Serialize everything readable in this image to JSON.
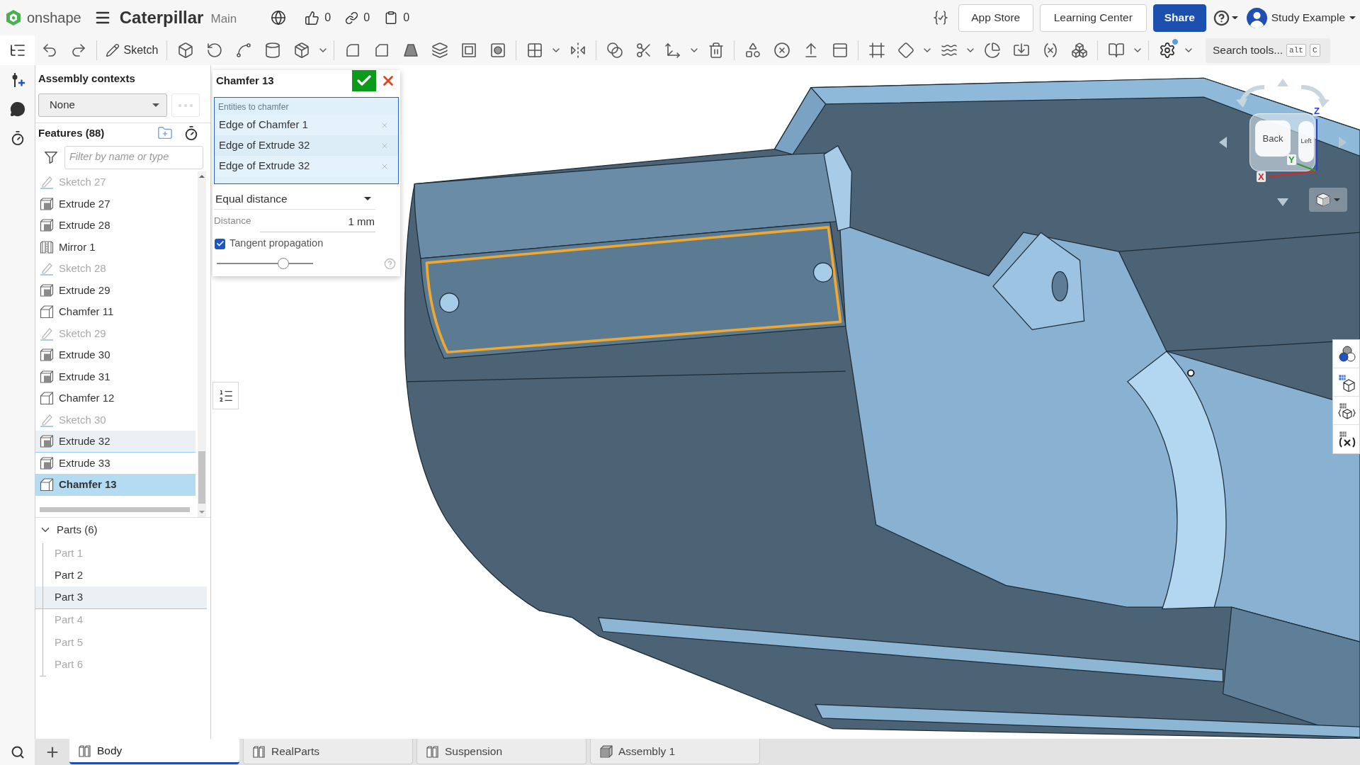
{
  "header": {
    "logo": "onshape",
    "title": "Caterpillar",
    "branch": "Main",
    "counters": [
      {
        "kind": "likes",
        "value": "0"
      },
      {
        "kind": "links",
        "value": "0"
      },
      {
        "kind": "copies",
        "value": "0"
      }
    ],
    "buttons": [
      {
        "label": "App Store",
        "kind": "outline"
      },
      {
        "label": "Learning Center",
        "kind": "outline"
      },
      {
        "label": "Share",
        "kind": "primary"
      }
    ],
    "user": "Study Example"
  },
  "toolbar": {
    "sketch_label": "Sketch",
    "search": {
      "label": "Search tools...",
      "keys": [
        "alt",
        "C"
      ]
    }
  },
  "assembly_contexts": {
    "title": "Assembly contexts",
    "value": "None",
    "more_button": {
      "disabled": true
    }
  },
  "features": {
    "title": "Features (88)",
    "filter_placeholder": "Filter by name or type",
    "items": [
      {
        "label": "Sketch 27",
        "kind": "sketch",
        "hidden": true,
        "highlighted": false,
        "selected": false
      },
      {
        "label": "Extrude 27",
        "kind": "extrude",
        "hidden": false,
        "highlighted": false,
        "selected": false
      },
      {
        "label": "Extrude 28",
        "kind": "extrude",
        "hidden": false,
        "highlighted": false,
        "selected": false
      },
      {
        "label": "Mirror 1",
        "kind": "mirror",
        "hidden": false,
        "highlighted": false,
        "selected": false
      },
      {
        "label": "Sketch 28",
        "kind": "sketch",
        "hidden": true,
        "highlighted": false,
        "selected": false
      },
      {
        "label": "Extrude 29",
        "kind": "extrude",
        "hidden": false,
        "highlighted": false,
        "selected": false
      },
      {
        "label": "Chamfer 11",
        "kind": "chamfer",
        "hidden": false,
        "highlighted": false,
        "selected": false
      },
      {
        "label": "Sketch 29",
        "kind": "sketch",
        "hidden": true,
        "highlighted": false,
        "selected": false
      },
      {
        "label": "Extrude 30",
        "kind": "extrude",
        "hidden": false,
        "highlighted": false,
        "selected": false
      },
      {
        "label": "Extrude 31",
        "kind": "extrude",
        "hidden": false,
        "highlighted": false,
        "selected": false
      },
      {
        "label": "Chamfer 12",
        "kind": "chamfer",
        "hidden": false,
        "highlighted": false,
        "selected": false
      },
      {
        "label": "Sketch 30",
        "kind": "sketch",
        "hidden": true,
        "highlighted": false,
        "selected": false
      },
      {
        "label": "Extrude 32",
        "kind": "extrude",
        "hidden": false,
        "highlighted": true,
        "selected": false
      },
      {
        "label": "Extrude 33",
        "kind": "extrude",
        "hidden": false,
        "highlighted": false,
        "selected": false
      },
      {
        "label": "Chamfer 13",
        "kind": "chamfer",
        "hidden": false,
        "highlighted": false,
        "selected": true
      }
    ]
  },
  "parts": {
    "title": "Parts (6)",
    "expanded": true,
    "items": [
      {
        "label": "Part 1",
        "hidden": true,
        "highlighted": false,
        "selected": false
      },
      {
        "label": "Part 2",
        "hidden": false,
        "highlighted": false,
        "selected": false
      },
      {
        "label": "Part 3",
        "hidden": false,
        "highlighted": true,
        "selected": false
      },
      {
        "label": "Part 4",
        "hidden": true,
        "highlighted": false,
        "selected": false
      },
      {
        "label": "Part 5",
        "hidden": true,
        "highlighted": false,
        "selected": false
      },
      {
        "label": "Part 6",
        "hidden": true,
        "highlighted": false,
        "selected": false
      }
    ]
  },
  "dialog": {
    "title": "Chamfer 13",
    "entities_label": "Entities to chamfer",
    "entities": [
      "Edge of Chamfer 1",
      "Edge of Extrude 32",
      "Edge of Extrude 32"
    ],
    "chamfer_type": "Equal distance",
    "distance": {
      "label": "Distance",
      "value": "1 mm"
    },
    "tangent_propagation": {
      "label": "Tangent propagation",
      "checked": true
    },
    "slider": {
      "level": 0.69
    }
  },
  "view_cube": {
    "faces": [
      "Back",
      "Left"
    ],
    "axes": [
      {
        "label": "X",
        "color": "#d42a2a"
      },
      {
        "label": "Y",
        "color": "#2a9f2a"
      },
      {
        "label": "Z",
        "color": "#2a3fd4"
      }
    ]
  },
  "tabs": [
    {
      "label": "Body",
      "kind": "part_studio",
      "selected": true
    },
    {
      "label": "RealParts",
      "kind": "part_studio",
      "selected": false
    },
    {
      "label": "Suspension",
      "kind": "part_studio",
      "selected": false
    },
    {
      "label": "Assembly 1",
      "kind": "assembly",
      "selected": false
    }
  ]
}
